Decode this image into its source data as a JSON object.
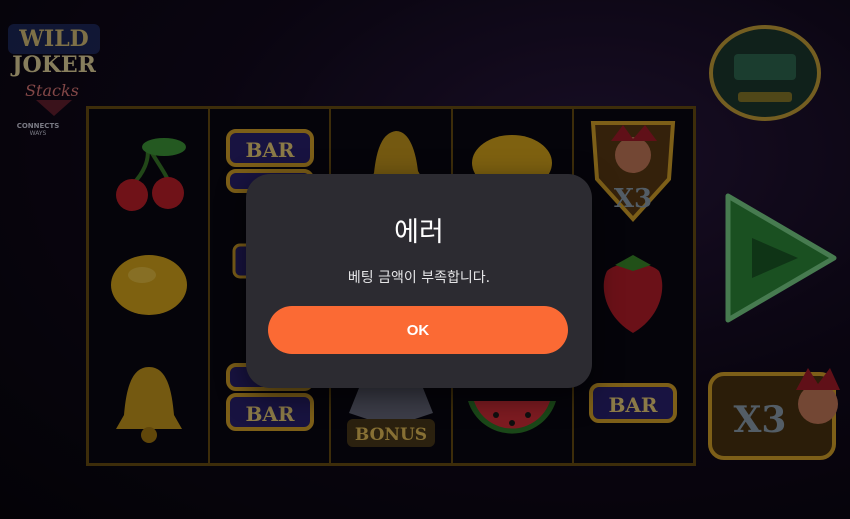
{
  "colors": {
    "modal_bg": "#2c2b31",
    "accent_button": "#fb6a34",
    "reel_frame": "#6a4e12",
    "spin_green": "#3fbf5a"
  },
  "game": {
    "logo_text": [
      "WILD",
      "JOKER",
      "Stacks"
    ],
    "logo_footer": "CONNECTS WAYS"
  },
  "reels": [
    {
      "symbols": [
        "cherry-icon",
        "lemon-icon",
        "bell-icon"
      ]
    },
    {
      "symbols": [
        "bar-icon",
        "bar-icon",
        "bar-icon"
      ]
    },
    {
      "symbols": [
        "bell-icon",
        "blank",
        "bonus-icon"
      ]
    },
    {
      "symbols": [
        "lemon-icon",
        "blank",
        "watermelon-icon"
      ]
    },
    {
      "symbols": [
        "joker-x3-icon",
        "strawberry-icon",
        "bar-icon"
      ]
    }
  ],
  "symbol_text": {
    "bar": "BAR",
    "x3": "X3",
    "bonus": "BONUS"
  },
  "dialog": {
    "title": "에러",
    "message": "베팅 금액이 부족합니다.",
    "ok_label": "OK"
  }
}
